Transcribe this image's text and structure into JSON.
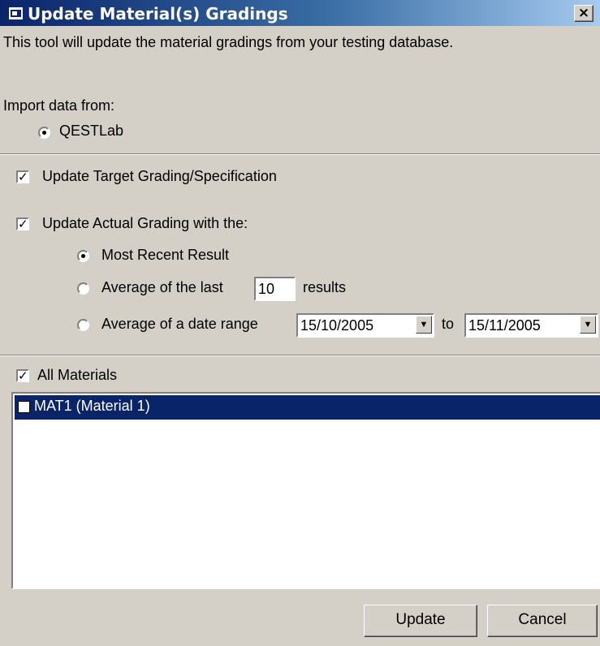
{
  "window": {
    "title": "Update Material(s) Gradings",
    "close_glyph": "×"
  },
  "intro": {
    "description": "This tool will update the material gradings from your testing database.",
    "import_label": "Import data from:",
    "source_option": "QESTLab"
  },
  "options": {
    "update_target": {
      "label": "Update Target Grading/Specification",
      "checked": true
    },
    "update_actual": {
      "label": "Update Actual Grading with the:",
      "checked": true
    },
    "most_recent": "Most Recent Result",
    "average_last": {
      "prefix": "Average of the last",
      "count": "10",
      "suffix": "results"
    },
    "date_range": {
      "prefix": "Average of a date range",
      "from": "15/10/2005",
      "to_label": "to",
      "to": "15/11/2005"
    }
  },
  "materials": {
    "all_label": "All Materials",
    "items": [
      {
        "label": "MAT1 (Material 1)",
        "checked": true
      }
    ]
  },
  "buttons": {
    "update": "Update",
    "cancel": "Cancel"
  },
  "glyphs": {
    "check": "✓",
    "dropdown": "▼"
  },
  "colors": {
    "title_start": "#0a246a",
    "title_end": "#a6caf0",
    "selection": "#0a246a",
    "face": "#d4d0c8"
  }
}
